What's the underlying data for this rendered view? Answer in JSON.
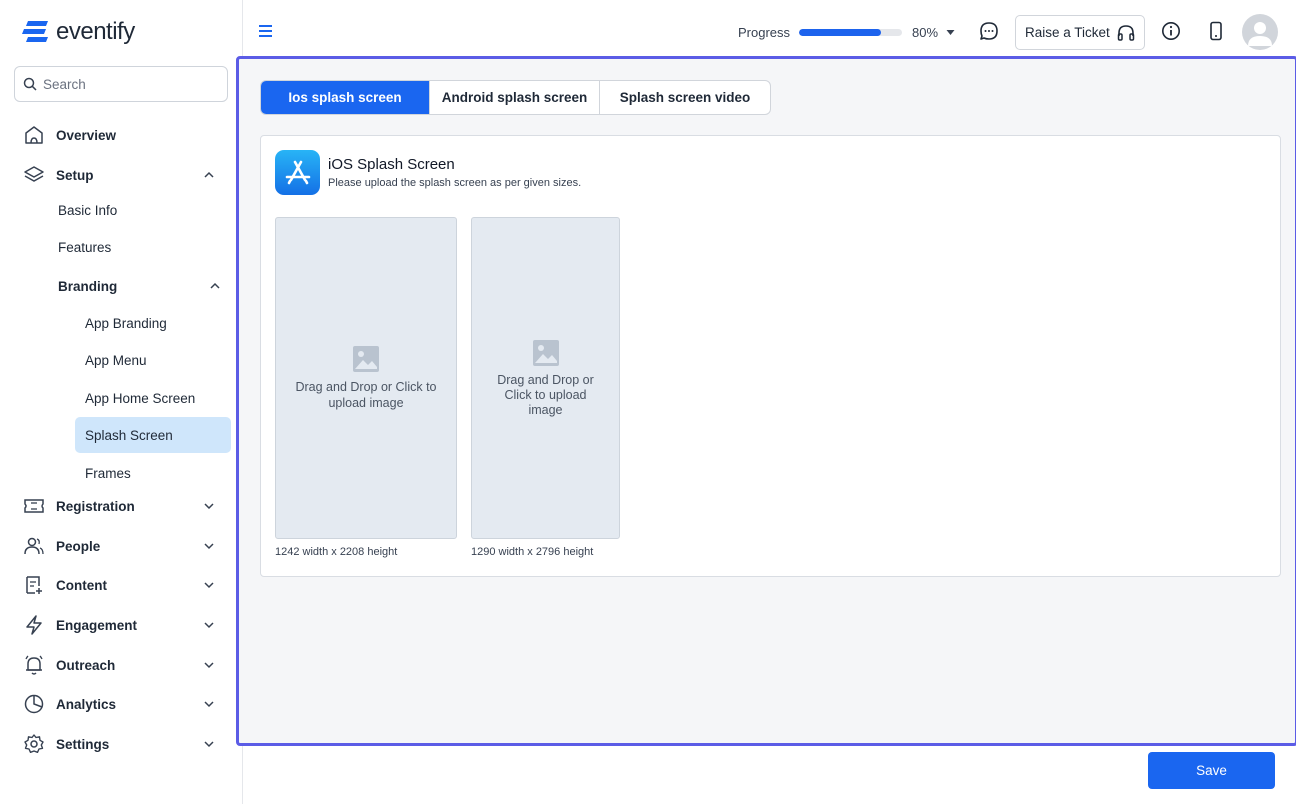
{
  "brand": {
    "name": "eventify",
    "accent": "#1a66f0"
  },
  "search": {
    "placeholder": "Search"
  },
  "sidebar": {
    "overview": "Overview",
    "setup": "Setup",
    "setup_children": {
      "basic_info": "Basic Info",
      "features": "Features",
      "branding": "Branding",
      "branding_children": {
        "app_branding": "App Branding",
        "app_menu": "App Menu",
        "app_home_screen": "App Home Screen",
        "splash_screen": "Splash Screen",
        "frames": "Frames"
      }
    },
    "registration": "Registration",
    "people": "People",
    "content": "Content",
    "engagement": "Engagement",
    "outreach": "Outreach",
    "analytics": "Analytics",
    "settings": "Settings"
  },
  "topbar": {
    "progress_label": "Progress",
    "progress_value": 80,
    "progress_text": "80%",
    "ticket_label": "Raise a Ticket"
  },
  "tabs": [
    {
      "label": "Ios splash screen",
      "active": true
    },
    {
      "label": "Android splash screen",
      "active": false
    },
    {
      "label": "Splash screen video",
      "active": false
    }
  ],
  "card": {
    "title": "iOS Splash Screen",
    "subtitle": "Please upload the splash screen as per given sizes."
  },
  "uploads": [
    {
      "label": "Drag and Drop or Click to upload image",
      "size": "1242 width x 2208 height"
    },
    {
      "label": "Drag and Drop or Click to upload image",
      "size": "1290 width x 2796 height"
    }
  ],
  "footer": {
    "save_label": "Save"
  }
}
